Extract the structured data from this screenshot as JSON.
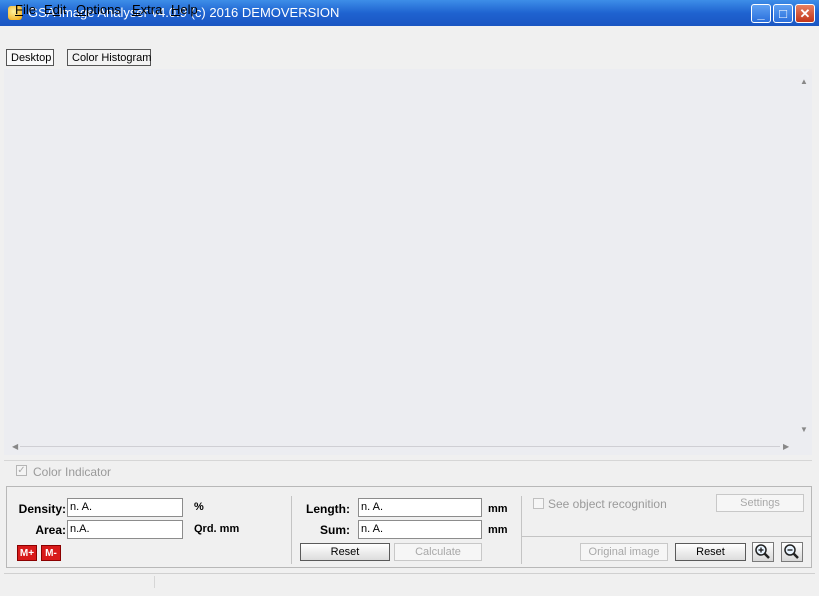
{
  "window": {
    "title": "GSA Image Analyser v4.0.9 (c) 2016   DEMOVERSION",
    "controls": {
      "minimize": "_",
      "maximize": "□",
      "close": "✕"
    }
  },
  "menu": [
    {
      "label": "File",
      "underline": "F",
      "rest": "ile"
    },
    {
      "label": "Edit",
      "underline": "d",
      "pre": "E",
      "rest": "it"
    },
    {
      "label": "Options",
      "underline": "O",
      "rest": "ptions"
    },
    {
      "label": "Extra",
      "underline": "E",
      "rest": "xtra"
    },
    {
      "label": "Help",
      "underline": "H",
      "rest": "elp"
    }
  ],
  "tabs": [
    "Desktop",
    "Color Histogram"
  ],
  "color_indicator": {
    "label": "Color Indicator",
    "checked": true,
    "enabled": false
  },
  "measure_left": {
    "density_label": "Density:",
    "density_value": "n. A.",
    "density_unit": "%",
    "area_label": "Area:",
    "area_value": "n.A.",
    "area_unit": "Qrd. mm",
    "mplus": "M+",
    "mminus": "M-"
  },
  "measure_mid": {
    "length_label": "Length:",
    "length_value": "n. A.",
    "length_unit": "mm",
    "sum_label": "Sum:",
    "sum_value": "n. A.",
    "sum_unit": "mm",
    "reset": "Reset",
    "calculate": "Calculate"
  },
  "measure_right": {
    "object_recognition": "See object recognition",
    "settings": "Settings",
    "original_image": "Original image",
    "reset": "Reset"
  },
  "icons": {
    "zoom_in": "zoom-in-icon",
    "zoom_out": "zoom-out-icon"
  },
  "colors": {
    "titlebar": "#1f63d0",
    "canvas": "#ecedf1",
    "mbutton": "#d81b1b"
  }
}
